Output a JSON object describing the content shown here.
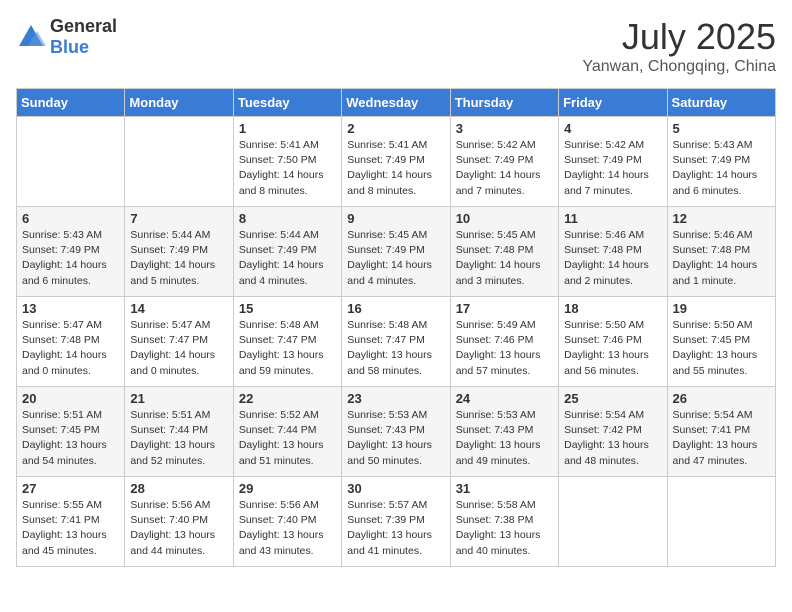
{
  "header": {
    "logo_general": "General",
    "logo_blue": "Blue",
    "month": "July 2025",
    "location": "Yanwan, Chongqing, China"
  },
  "weekdays": [
    "Sunday",
    "Monday",
    "Tuesday",
    "Wednesday",
    "Thursday",
    "Friday",
    "Saturday"
  ],
  "weeks": [
    [
      {
        "day": "",
        "info": ""
      },
      {
        "day": "",
        "info": ""
      },
      {
        "day": "1",
        "info": "Sunrise: 5:41 AM\nSunset: 7:50 PM\nDaylight: 14 hours and 8 minutes."
      },
      {
        "day": "2",
        "info": "Sunrise: 5:41 AM\nSunset: 7:49 PM\nDaylight: 14 hours and 8 minutes."
      },
      {
        "day": "3",
        "info": "Sunrise: 5:42 AM\nSunset: 7:49 PM\nDaylight: 14 hours and 7 minutes."
      },
      {
        "day": "4",
        "info": "Sunrise: 5:42 AM\nSunset: 7:49 PM\nDaylight: 14 hours and 7 minutes."
      },
      {
        "day": "5",
        "info": "Sunrise: 5:43 AM\nSunset: 7:49 PM\nDaylight: 14 hours and 6 minutes."
      }
    ],
    [
      {
        "day": "6",
        "info": "Sunrise: 5:43 AM\nSunset: 7:49 PM\nDaylight: 14 hours and 6 minutes."
      },
      {
        "day": "7",
        "info": "Sunrise: 5:44 AM\nSunset: 7:49 PM\nDaylight: 14 hours and 5 minutes."
      },
      {
        "day": "8",
        "info": "Sunrise: 5:44 AM\nSunset: 7:49 PM\nDaylight: 14 hours and 4 minutes."
      },
      {
        "day": "9",
        "info": "Sunrise: 5:45 AM\nSunset: 7:49 PM\nDaylight: 14 hours and 4 minutes."
      },
      {
        "day": "10",
        "info": "Sunrise: 5:45 AM\nSunset: 7:48 PM\nDaylight: 14 hours and 3 minutes."
      },
      {
        "day": "11",
        "info": "Sunrise: 5:46 AM\nSunset: 7:48 PM\nDaylight: 14 hours and 2 minutes."
      },
      {
        "day": "12",
        "info": "Sunrise: 5:46 AM\nSunset: 7:48 PM\nDaylight: 14 hours and 1 minute."
      }
    ],
    [
      {
        "day": "13",
        "info": "Sunrise: 5:47 AM\nSunset: 7:48 PM\nDaylight: 14 hours and 0 minutes."
      },
      {
        "day": "14",
        "info": "Sunrise: 5:47 AM\nSunset: 7:47 PM\nDaylight: 14 hours and 0 minutes."
      },
      {
        "day": "15",
        "info": "Sunrise: 5:48 AM\nSunset: 7:47 PM\nDaylight: 13 hours and 59 minutes."
      },
      {
        "day": "16",
        "info": "Sunrise: 5:48 AM\nSunset: 7:47 PM\nDaylight: 13 hours and 58 minutes."
      },
      {
        "day": "17",
        "info": "Sunrise: 5:49 AM\nSunset: 7:46 PM\nDaylight: 13 hours and 57 minutes."
      },
      {
        "day": "18",
        "info": "Sunrise: 5:50 AM\nSunset: 7:46 PM\nDaylight: 13 hours and 56 minutes."
      },
      {
        "day": "19",
        "info": "Sunrise: 5:50 AM\nSunset: 7:45 PM\nDaylight: 13 hours and 55 minutes."
      }
    ],
    [
      {
        "day": "20",
        "info": "Sunrise: 5:51 AM\nSunset: 7:45 PM\nDaylight: 13 hours and 54 minutes."
      },
      {
        "day": "21",
        "info": "Sunrise: 5:51 AM\nSunset: 7:44 PM\nDaylight: 13 hours and 52 minutes."
      },
      {
        "day": "22",
        "info": "Sunrise: 5:52 AM\nSunset: 7:44 PM\nDaylight: 13 hours and 51 minutes."
      },
      {
        "day": "23",
        "info": "Sunrise: 5:53 AM\nSunset: 7:43 PM\nDaylight: 13 hours and 50 minutes."
      },
      {
        "day": "24",
        "info": "Sunrise: 5:53 AM\nSunset: 7:43 PM\nDaylight: 13 hours and 49 minutes."
      },
      {
        "day": "25",
        "info": "Sunrise: 5:54 AM\nSunset: 7:42 PM\nDaylight: 13 hours and 48 minutes."
      },
      {
        "day": "26",
        "info": "Sunrise: 5:54 AM\nSunset: 7:41 PM\nDaylight: 13 hours and 47 minutes."
      }
    ],
    [
      {
        "day": "27",
        "info": "Sunrise: 5:55 AM\nSunset: 7:41 PM\nDaylight: 13 hours and 45 minutes."
      },
      {
        "day": "28",
        "info": "Sunrise: 5:56 AM\nSunset: 7:40 PM\nDaylight: 13 hours and 44 minutes."
      },
      {
        "day": "29",
        "info": "Sunrise: 5:56 AM\nSunset: 7:40 PM\nDaylight: 13 hours and 43 minutes."
      },
      {
        "day": "30",
        "info": "Sunrise: 5:57 AM\nSunset: 7:39 PM\nDaylight: 13 hours and 41 minutes."
      },
      {
        "day": "31",
        "info": "Sunrise: 5:58 AM\nSunset: 7:38 PM\nDaylight: 13 hours and 40 minutes."
      },
      {
        "day": "",
        "info": ""
      },
      {
        "day": "",
        "info": ""
      }
    ]
  ]
}
